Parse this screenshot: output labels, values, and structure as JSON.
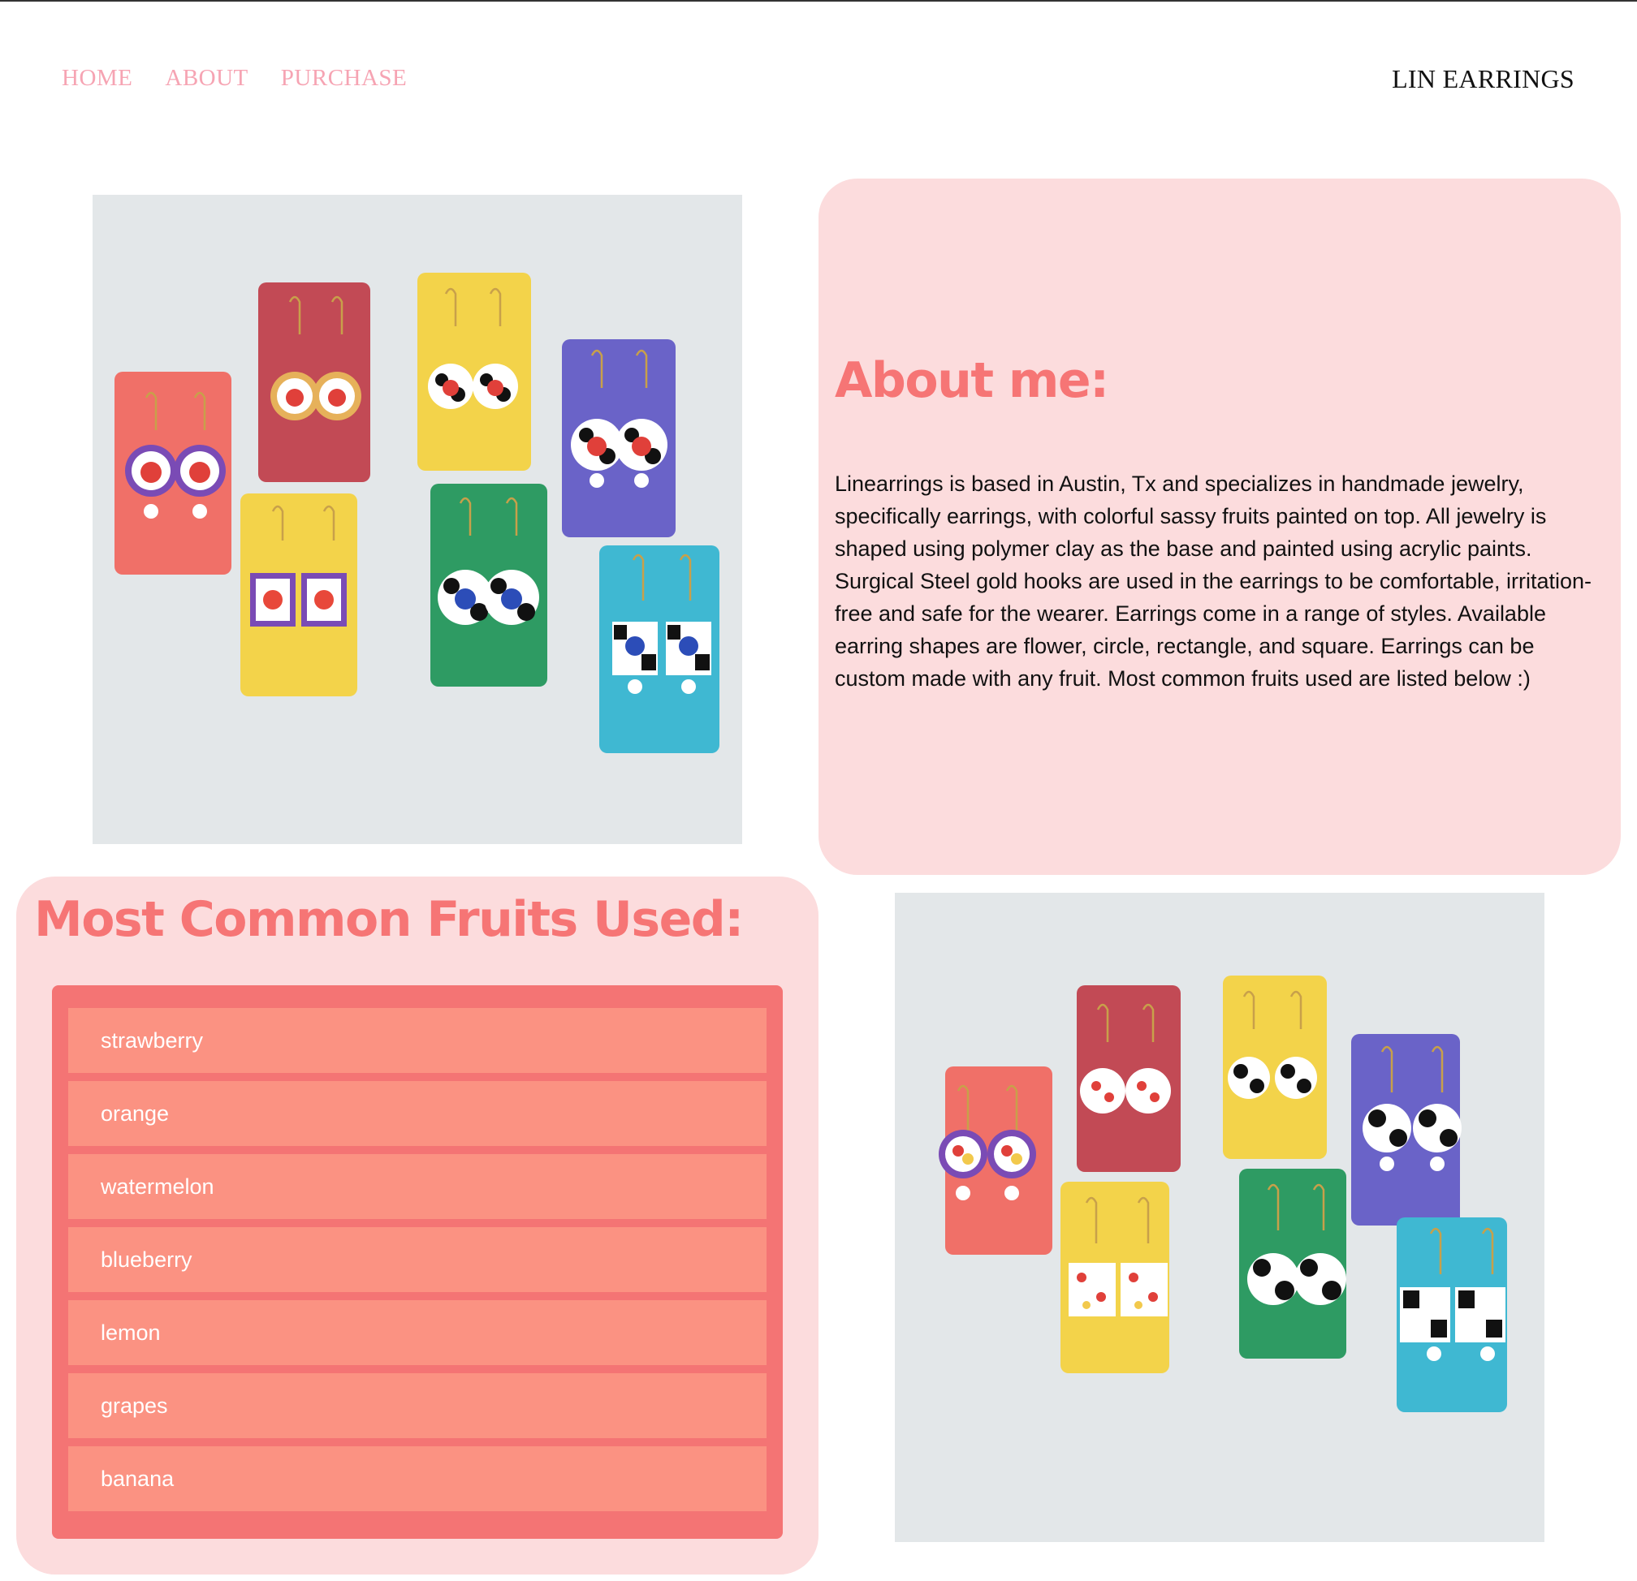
{
  "nav": {
    "items": [
      {
        "label": "HOME"
      },
      {
        "label": "ABOUT"
      },
      {
        "label": "PURCHASE"
      }
    ],
    "brand": "LIN EARRINGS"
  },
  "about": {
    "title": "About me:",
    "body": "Linearrings is based in Austin, Tx and specializes in handmade jewelry, specifically earrings, with colorful sassy fruits painted on top. All jewelry is shaped using polymer clay as the base and painted using acrylic paints. Surgical Steel gold hooks are used in the earrings to be comfortable, irritation-free and safe for the wearer. Earrings come in a range of styles. Available earring shapes are flower, circle, rectangle, and square. Earrings can be custom made with any fruit. Most common fruits used are listed below :)"
  },
  "fruits": {
    "title": "Most Common Fruits Used:",
    "items": [
      "strawberry",
      "orange",
      "watermelon",
      "blueberry",
      "lemon",
      "grapes",
      "banana"
    ]
  },
  "colors": {
    "nav_link": "#f6a4b3",
    "panel_bg": "#fcdcdd",
    "heading": "#f67575",
    "list_bg": "#f47474",
    "list_item_bg": "#fb9282"
  }
}
